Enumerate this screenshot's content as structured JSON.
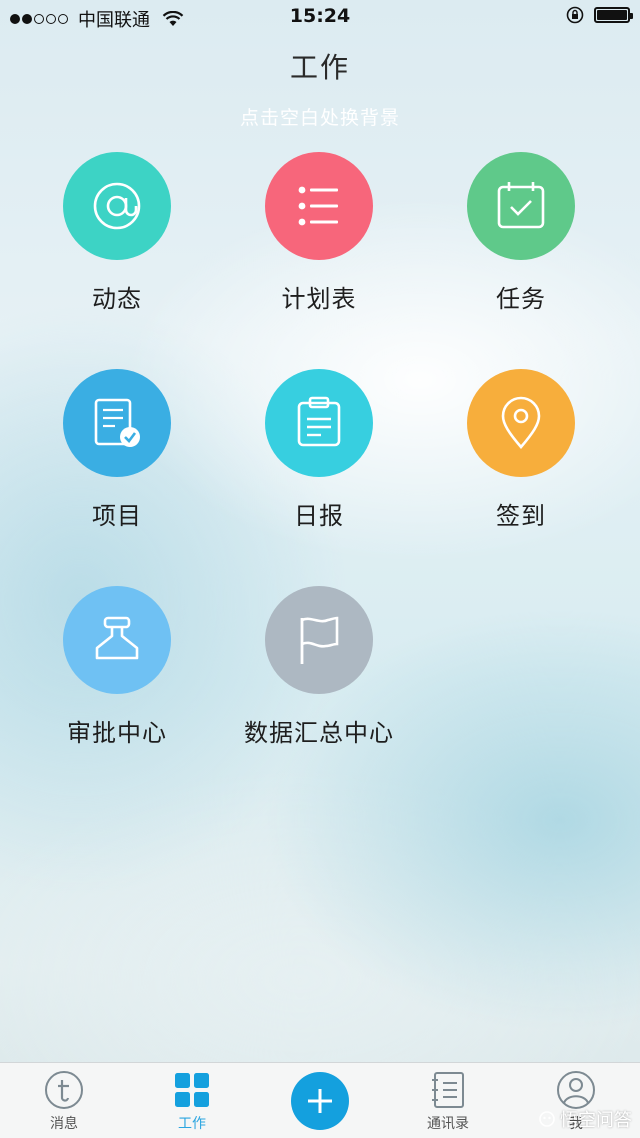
{
  "status_bar": {
    "carrier": "中国联通",
    "time": "15:24",
    "battery_level": 1.0
  },
  "header": {
    "title": "工作",
    "hint": "点击空白处换背景"
  },
  "apps": [
    {
      "label": "动态",
      "icon": "at-icon",
      "color": "#3dd3c5"
    },
    {
      "label": "计划表",
      "icon": "list-icon",
      "color": "#f7667b"
    },
    {
      "label": "任务",
      "icon": "calendar-check-icon",
      "color": "#5fc98a"
    },
    {
      "label": "项目",
      "icon": "document-check-icon",
      "color": "#3aaee3"
    },
    {
      "label": "日报",
      "icon": "clipboard-icon",
      "color": "#37cfe0"
    },
    {
      "label": "签到",
      "icon": "location-pin-icon",
      "color": "#f7ae3c"
    },
    {
      "label": "审批中心",
      "icon": "stamp-icon",
      "color": "#6fc1f3"
    },
    {
      "label": "数据汇总中心",
      "icon": "flag-icon",
      "color": "#adb8c2"
    }
  ],
  "tab_bar": {
    "tabs": [
      {
        "label": "消息",
        "icon": "message-icon"
      },
      {
        "label": "工作",
        "icon": "grid-icon",
        "active": true
      },
      {
        "label": "",
        "icon": "plus-icon"
      },
      {
        "label": "通讯录",
        "icon": "contacts-icon"
      },
      {
        "label": "我",
        "icon": "profile-icon"
      }
    ],
    "accent": "#14a0de"
  },
  "watermark": "悟空问答"
}
